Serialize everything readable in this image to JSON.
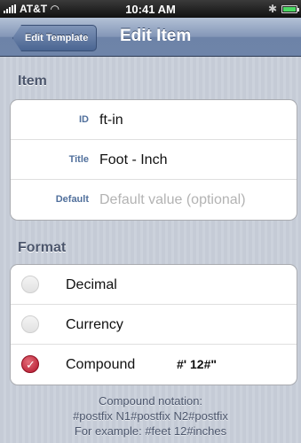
{
  "status_bar": {
    "carrier": "AT&T",
    "time": "10:41 AM",
    "signal_icon": "signal-bars-icon",
    "wifi_icon": "wifi-icon",
    "bluetooth_icon": "bluetooth-icon",
    "battery_icon": "battery-icon",
    "battery_color": "#4cd964"
  },
  "nav": {
    "back_label": "Edit Template",
    "title": "Edit Item"
  },
  "item_section": {
    "header": "Item",
    "fields": [
      {
        "label": "ID",
        "value": "ft-in",
        "placeholder": ""
      },
      {
        "label": "Title",
        "value": "Foot - Inch",
        "placeholder": ""
      },
      {
        "label": "Default",
        "value": "",
        "placeholder": "Default value (optional)"
      }
    ]
  },
  "format_section": {
    "header": "Format",
    "options": [
      {
        "label": "Decimal",
        "detail": "",
        "selected": false
      },
      {
        "label": "Currency",
        "detail": "",
        "selected": false
      },
      {
        "label": "Compound",
        "detail": "#' 12#\"",
        "selected": true
      }
    ],
    "selected_color": "#b2132a"
  },
  "footer": {
    "line1": "Compound notation:",
    "line2": "#postfix N1#postfix N2#postfix",
    "line3": "For example: #feet 12#inches"
  }
}
